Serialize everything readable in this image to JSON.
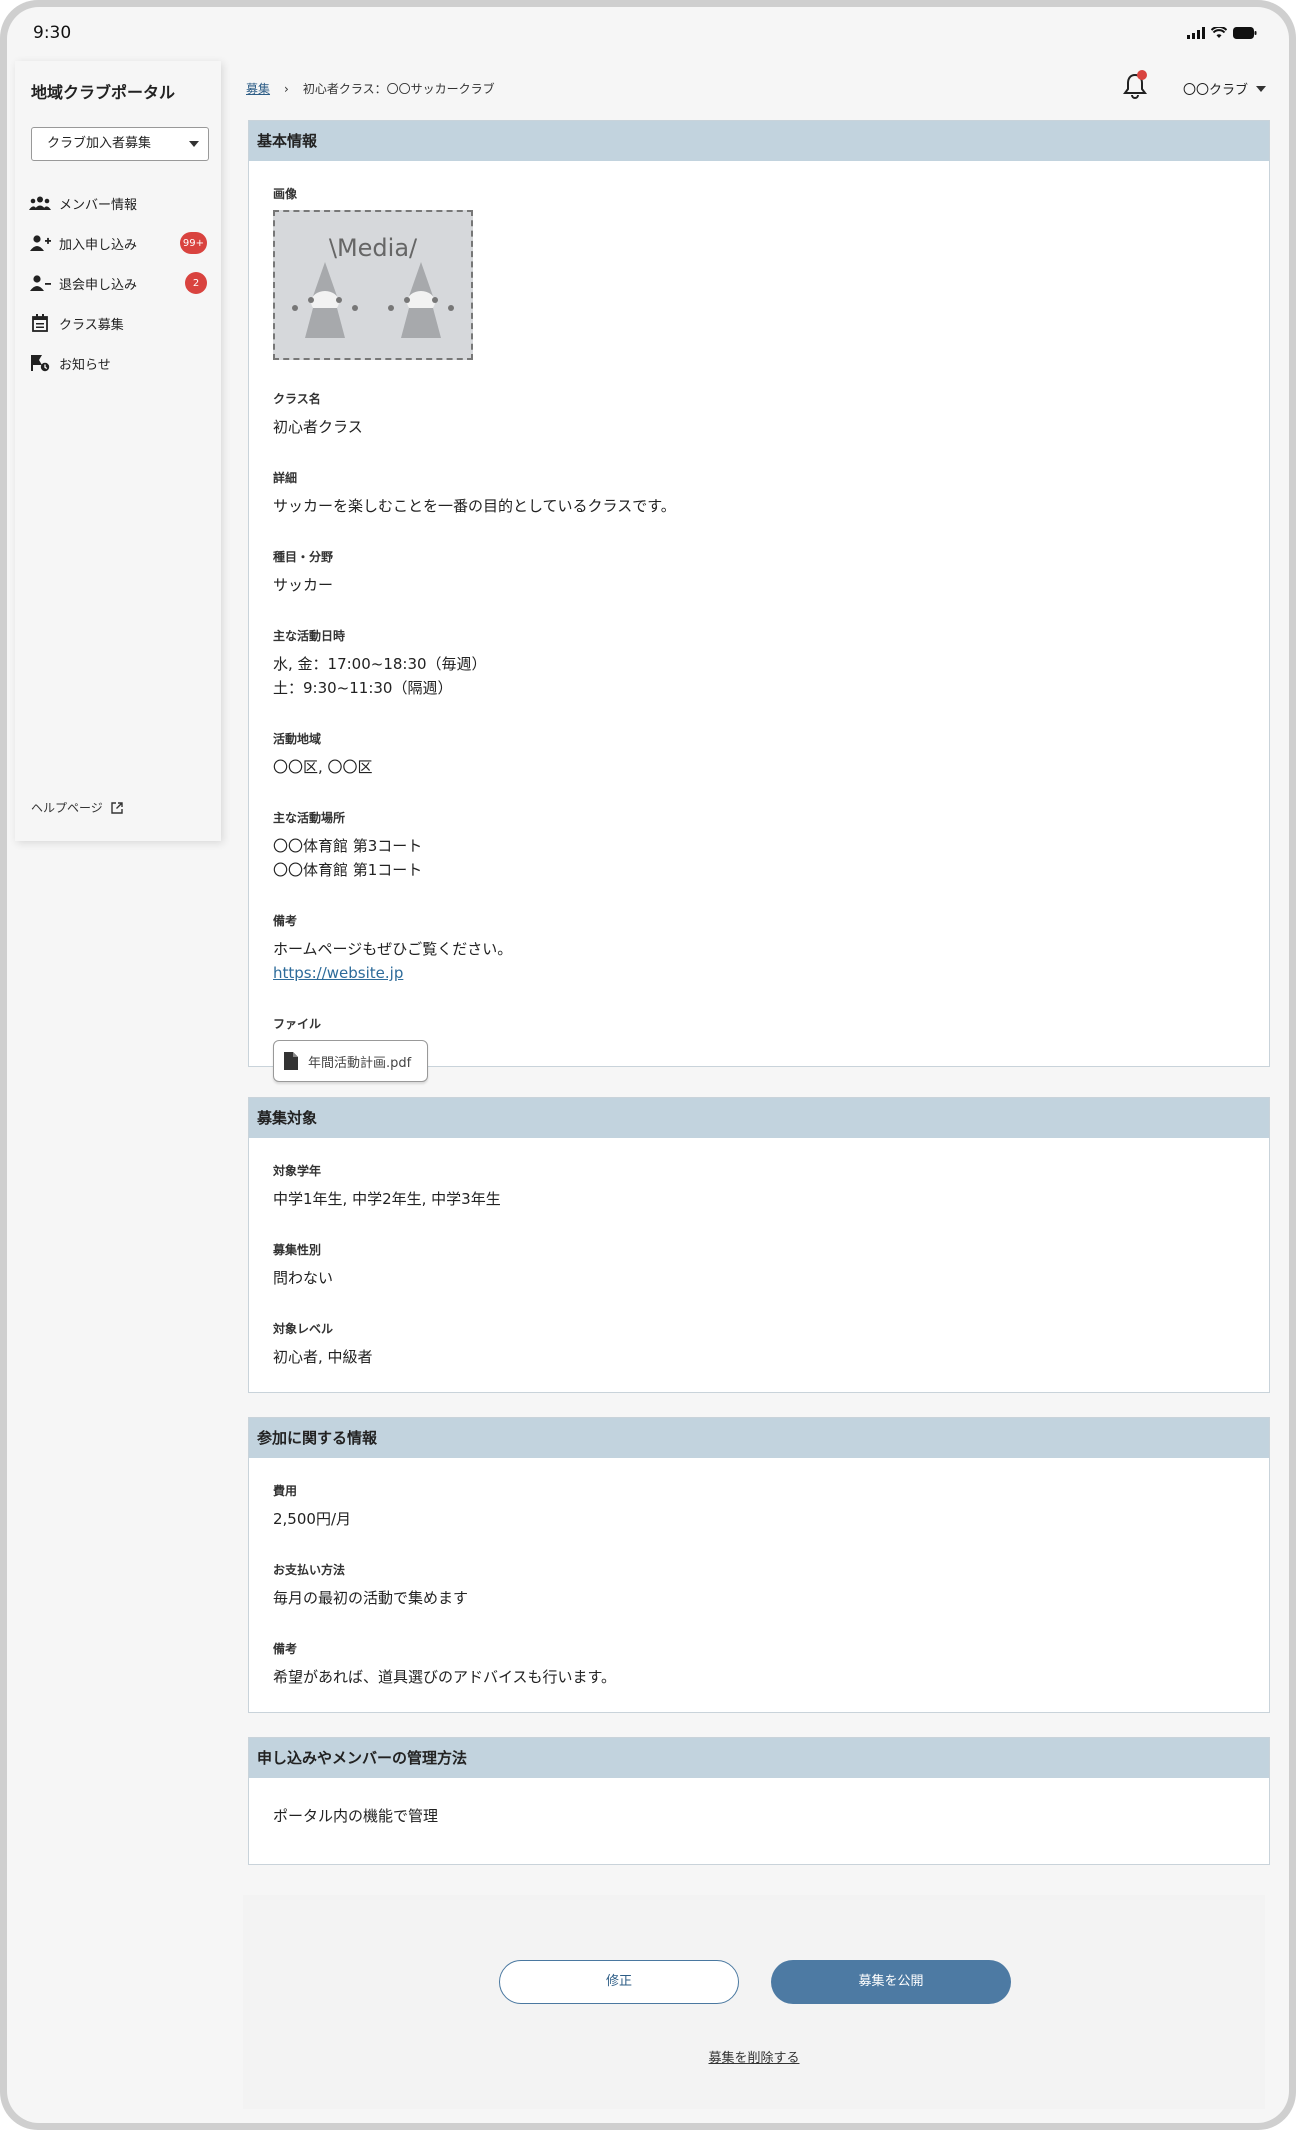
{
  "status_bar": {
    "time": "9:30"
  },
  "sidebar": {
    "app_title": "地域クラブポータル",
    "selector_value": "クラブ加入者募集",
    "items": [
      {
        "label": "メンバー情報",
        "icon": "members-icon",
        "badge": ""
      },
      {
        "label": "加入申し込み",
        "icon": "person-add-icon",
        "badge": "99+"
      },
      {
        "label": "退会申し込み",
        "icon": "person-remove-icon",
        "badge": "2"
      },
      {
        "label": "クラス募集",
        "icon": "calendar-icon",
        "badge": ""
      },
      {
        "label": "お知らせ",
        "icon": "notice-icon",
        "badge": ""
      }
    ],
    "help_label": "ヘルプページ"
  },
  "header": {
    "breadcrumb_root": "募集",
    "breadcrumb_current": "初心者クラス：〇〇サッカークラブ",
    "account_name": "〇〇クラブ"
  },
  "basic_info": {
    "title": "基本情報",
    "image_label": "画像",
    "image_placeholder": "\\Media/",
    "class_name_label": "クラス名",
    "class_name": "初心者クラス",
    "detail_label": "詳細",
    "detail": "サッカーを楽しむことを一番の目的としているクラスです。",
    "category_label": "種目・分野",
    "category": "サッカー",
    "schedule_label": "主な活動日時",
    "schedule_1": "水, 金：17:00~18:30（毎週）",
    "schedule_2": "土：9:30~11:30（隔週）",
    "area_label": "活動地域",
    "area": "〇〇区, 〇〇区",
    "place_label": "主な活動場所",
    "place_1": "〇〇体育館 第3コート",
    "place_2": "〇〇体育館 第1コート",
    "note_label": "備考",
    "note": "ホームページもぜひご覧ください。",
    "note_link": "https://website.jp",
    "file_label": "ファイル",
    "file_name": "年間活動計画.pdf"
  },
  "target": {
    "title": "募集対象",
    "grade_label": "対象学年",
    "grade": "中学1年生, 中学2年生, 中学3年生",
    "gender_label": "募集性別",
    "gender": "問わない",
    "level_label": "対象レベル",
    "level": "初心者, 中級者"
  },
  "participation": {
    "title": "参加に関する情報",
    "fee_label": "費用",
    "fee": "2,500円/月",
    "payment_label": "お支払い方法",
    "payment": "毎月の最初の活動で集めます",
    "note_label": "備考",
    "note": "希望があれば、道具選びのアドバイスも行います。"
  },
  "management": {
    "title": "申し込みやメンバーの管理方法",
    "value": "ポータル内の機能で管理"
  },
  "actions": {
    "edit_label": "修正",
    "publish_label": "募集を公開",
    "delete_label": "募集を削除する"
  }
}
